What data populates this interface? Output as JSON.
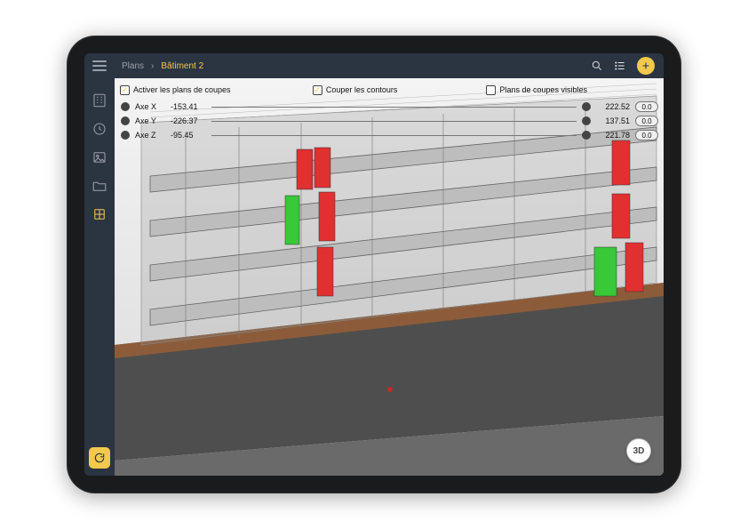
{
  "breadcrumb": {
    "root": "Plans",
    "sep": "›",
    "current": "Bâtiment 2"
  },
  "section": {
    "enable_label": "Activer les plans de coupes",
    "contours_label": "Couper les contours",
    "visible_label": "Plans de coupes visibles",
    "enable_checked": true,
    "contours_checked": true,
    "visible_checked": false,
    "axes": [
      {
        "label": "Axe X",
        "left": "-153.41",
        "right": "222.52",
        "pill": "0.0"
      },
      {
        "label": "Axe Y",
        "left": "-226.37",
        "right": "137.51",
        "pill": "0.0"
      },
      {
        "label": "Axe Z",
        "left": "-95.45",
        "right": "221.78",
        "pill": "0.0"
      }
    ]
  },
  "fab3d": "3D",
  "icons": {
    "hamburger": "menu-icon",
    "building": "building-icon",
    "clock": "clock-icon",
    "image": "image-icon",
    "folder": "folder-icon",
    "section": "section-plane-icon",
    "refresh": "refresh-icon",
    "search": "search-icon",
    "list": "list-icon",
    "add": "add-icon"
  }
}
